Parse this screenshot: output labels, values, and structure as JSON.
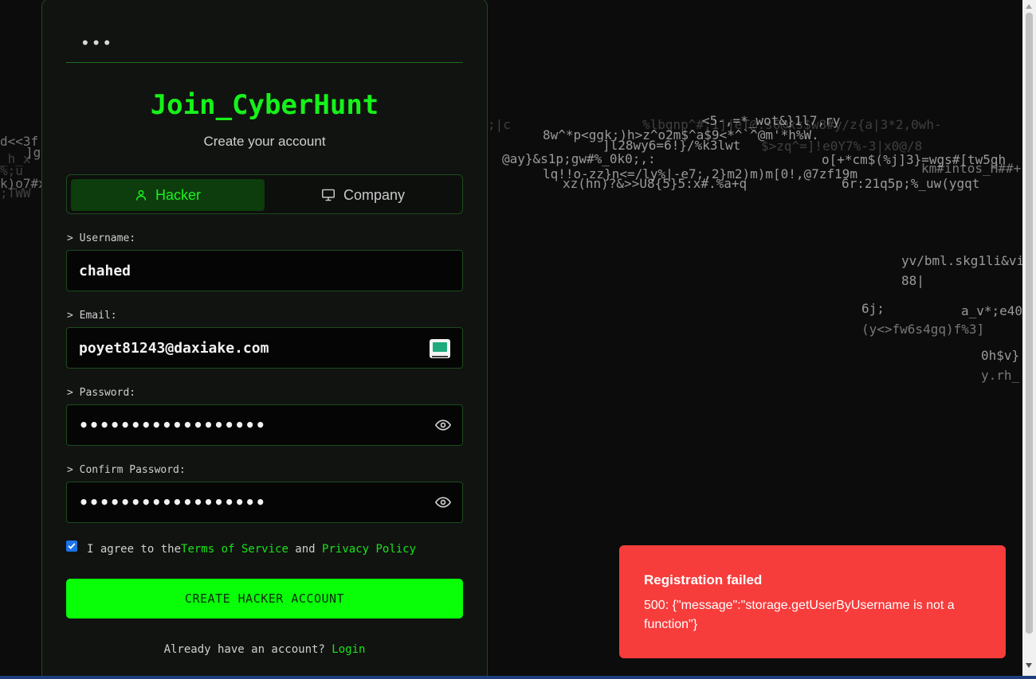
{
  "background_matrix": [
    {
      "text": "d<<3f",
      "cls": "mid"
    },
    {
      "text": "]g",
      "cls": "mid"
    },
    {
      "text": "_h_x",
      "cls": "dim"
    },
    {
      "text": "%;u",
      "cls": "dim"
    },
    {
      "text": "k)o7#x",
      "cls": "mid"
    },
    {
      "text": ";TWW",
      "cls": "dim"
    },
    {
      "text": ";|c",
      "cls": "dim"
    },
    {
      "text": "8w^*p<ggk;)h>z^o2m$^a$9<*^`^@m'*h%W.",
      "cls": ""
    },
    {
      "text": "%lbgnp^#;1]jeT@:s6@xs$w8#y/z{a|3*2,0wh-",
      "cls": "dim"
    },
    {
      "text": "<5-,=*_wot&}1l7,ry",
      "cls": ""
    },
    {
      "text": "]l28wy6=6!}/%k3lwt",
      "cls": ""
    },
    {
      "text": "$>zq^=]!e0Y7%-3|x0@/8",
      "cls": "dim"
    },
    {
      "text": "@ay}&s1p;gw#%_0k0;,:",
      "cls": ""
    },
    {
      "text": "o[+*cm$(%j]3}=wgs#[tw5gh",
      "cls": ""
    },
    {
      "text": "km#intos_H##+",
      "cls": "mid"
    },
    {
      "text": "lq!!o-zz}n<=/ly%|-e7;,2}m2)m)m[0!,@7zf19m",
      "cls": ""
    },
    {
      "text": "xz(hn)?&>>U8{5}5:x#.%a+q",
      "cls": ""
    },
    {
      "text": "6r:21q5p;%_uw(ygqt",
      "cls": ""
    },
    {
      "text": "yv/bml.skg1li&vi",
      "cls": ""
    },
    {
      "text": "88|",
      "cls": ""
    },
    {
      "text": "6j;",
      "cls": ""
    },
    {
      "text": "a_v*;e40",
      "cls": ""
    },
    {
      "text": "(y<>fw6s4gq)f%3]",
      "cls": "mid"
    },
    {
      "text": "0h$v}:",
      "cls": ""
    },
    {
      "text": "y.rh_",
      "cls": "mid"
    }
  ],
  "header": {
    "dots": "•••"
  },
  "title": "Join_CyberHunt",
  "subtitle": "Create your account",
  "tabs": {
    "hacker": {
      "label": "Hacker",
      "icon": "user-icon"
    },
    "company": {
      "label": "Company",
      "icon": "monitor-icon"
    }
  },
  "form": {
    "username_label": "> Username:",
    "username_value": "chahed",
    "email_label": "> Email:",
    "email_value": "poyet81243@daxiake.com",
    "password_label": "> Password:",
    "password_value": "••••••••••••••••••",
    "confirm_label": "> Confirm Password:",
    "confirm_value": "••••••••••••••••••"
  },
  "agree": {
    "prefix": "I agree to the ",
    "terms": "Terms of Service",
    "mid": " and ",
    "privacy": "Privacy Policy",
    "checked": true
  },
  "cta_label": "CREATE HACKER ACCOUNT",
  "login": {
    "prompt": "Already have an account? ",
    "link": "Login"
  },
  "toast": {
    "title": "Registration failed",
    "message": "500: {\"message\":\"storage.getUserByUsername is not a function\"}"
  },
  "colors": {
    "accent": "#16f21a",
    "error": "#f73c3c",
    "background": "#0c0c0c"
  }
}
